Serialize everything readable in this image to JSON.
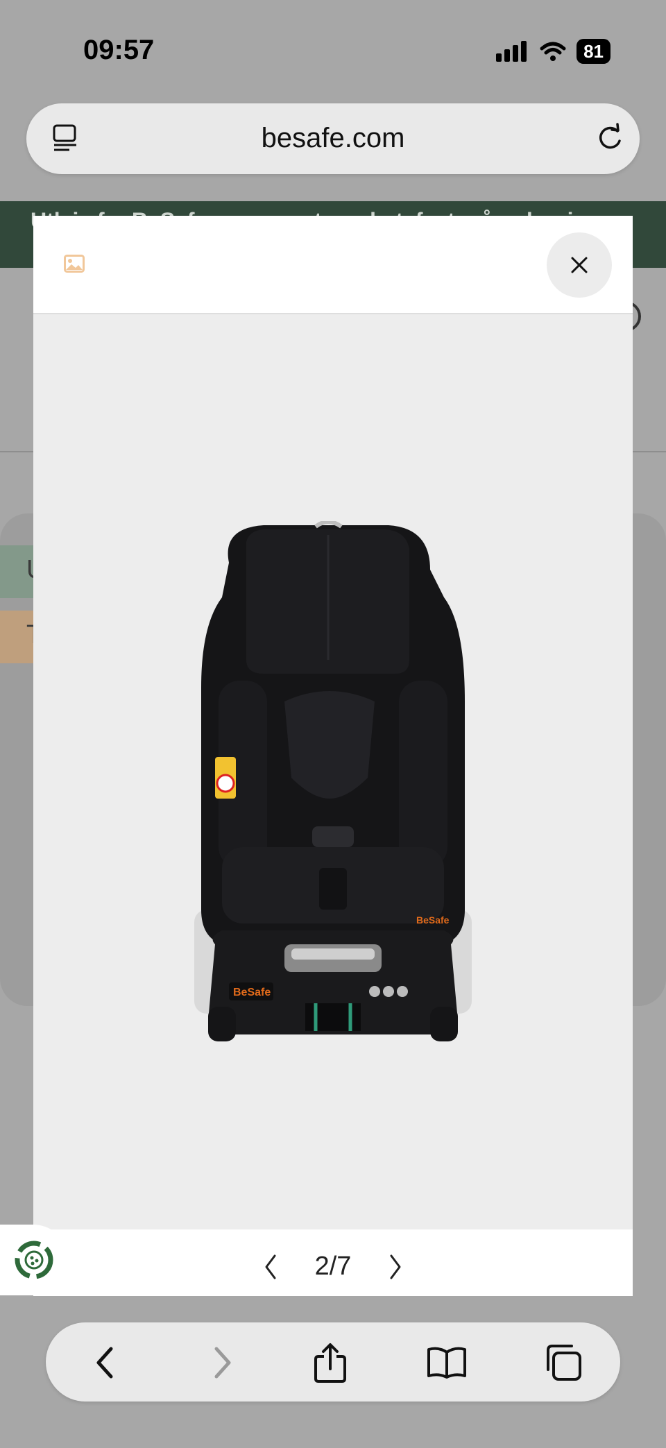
{
  "status_bar": {
    "time": "09:57",
    "battery": "81"
  },
  "browser": {
    "url": "besafe.com"
  },
  "background_page": {
    "banner_text": "Utleie fra BeSafe – samme trygghet, fast månedspris",
    "row1_letter": "U",
    "row2_letter": "T"
  },
  "modal": {
    "image_alt": "BeSafe car seat, black",
    "seat_brand": "BeSafe",
    "pager": {
      "current": 2,
      "total": 7,
      "label": "2/7"
    }
  },
  "icons": {
    "tabs_menu": "tabs-menu-icon",
    "reload": "reload-icon",
    "image": "image-icon",
    "close": "close-icon",
    "prev": "chevron-left-icon",
    "next": "chevron-right-icon",
    "recycle": "recycle-icon",
    "back": "back-icon",
    "forward": "forward-icon",
    "share": "share-icon",
    "bookmarks": "book-icon",
    "tabs": "tabs-icon"
  },
  "colors": {
    "banner": "#31483a",
    "accent_green": "#2e6a3a",
    "brand_orange": "#e06a1b"
  }
}
